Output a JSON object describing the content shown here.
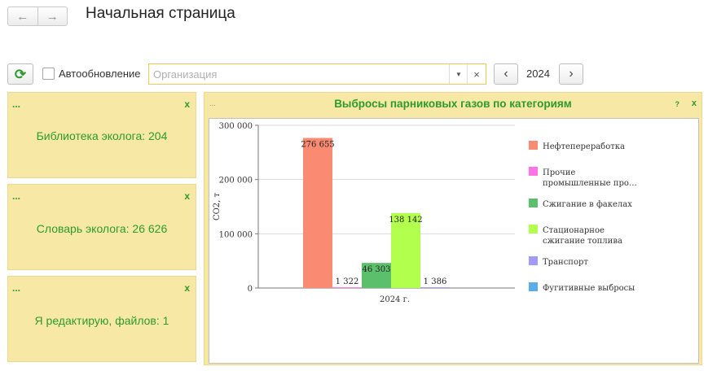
{
  "page": {
    "title": "Начальная страница",
    "nav_back_icon": "←",
    "nav_forward_icon": "→"
  },
  "toolbar": {
    "refresh_icon": "⟳",
    "auto_refresh_label": "Автообновление",
    "auto_refresh_checked": false,
    "organization_placeholder": "Организация",
    "organization_value": "",
    "dropdown_icon": "▼",
    "clear_icon": "×",
    "prev_icon": "‹",
    "year": "2024",
    "next_icon": "›"
  },
  "tiles": [
    {
      "dots": "...",
      "close": "x",
      "text": "Библиотека эколога: 204"
    },
    {
      "dots": "...",
      "close": "x",
      "text": "Словарь эколога: 26 626"
    },
    {
      "dots": "...",
      "close": "x",
      "text": "Я редактирую, файлов: 1"
    }
  ],
  "chart_panel": {
    "dots": "...",
    "title": "Выбросы парниковых газов по категориям",
    "help": "?",
    "close": "x"
  },
  "colors": {
    "accent_green": "#2e9a2e",
    "tile_bg": "#f8e8a6",
    "field_border": "#f3c94b"
  },
  "chart_data": {
    "type": "bar",
    "title": "Выбросы парниковых газов по категориям",
    "xlabel": "",
    "ylabel": "CO2, т",
    "categories": [
      "2024 г."
    ],
    "ylim": [
      0,
      300000
    ],
    "yticks": [
      0,
      100000,
      200000,
      300000
    ],
    "ytick_labels": [
      "0",
      "100 000",
      "200 000",
      "300 000"
    ],
    "legend_position": "right",
    "grid": true,
    "series": [
      {
        "name": "Нефтепереработка",
        "legend_lines": [
          "Нефтепереработка"
        ],
        "values": [
          276655
        ],
        "label": "276 655",
        "color": "#fa8a72"
      },
      {
        "name": "Прочие промышленные про…",
        "legend_lines": [
          "Прочие",
          "промышленные про…"
        ],
        "values": [
          1322
        ],
        "label": "1 322",
        "color": "#ff73e6"
      },
      {
        "name": "Сжигание в факелах",
        "legend_lines": [
          "Сжигание в факелах"
        ],
        "values": [
          46303
        ],
        "label": "46 303",
        "color": "#5cbf6b"
      },
      {
        "name": "Стационарное сжигание топлива",
        "legend_lines": [
          "Стационарное",
          "сжигание топлива"
        ],
        "values": [
          138142
        ],
        "label": "138 142",
        "color": "#b3ff4d"
      },
      {
        "name": "Транспорт",
        "legend_lines": [
          "Транспорт"
        ],
        "values": [
          1386
        ],
        "label": "1 386",
        "color": "#a09cf5"
      },
      {
        "name": "Фугитивные выбросы",
        "legend_lines": [
          "Фугитивные выбросы"
        ],
        "values": [
          null
        ],
        "label": "",
        "color": "#5aaee8"
      }
    ]
  }
}
